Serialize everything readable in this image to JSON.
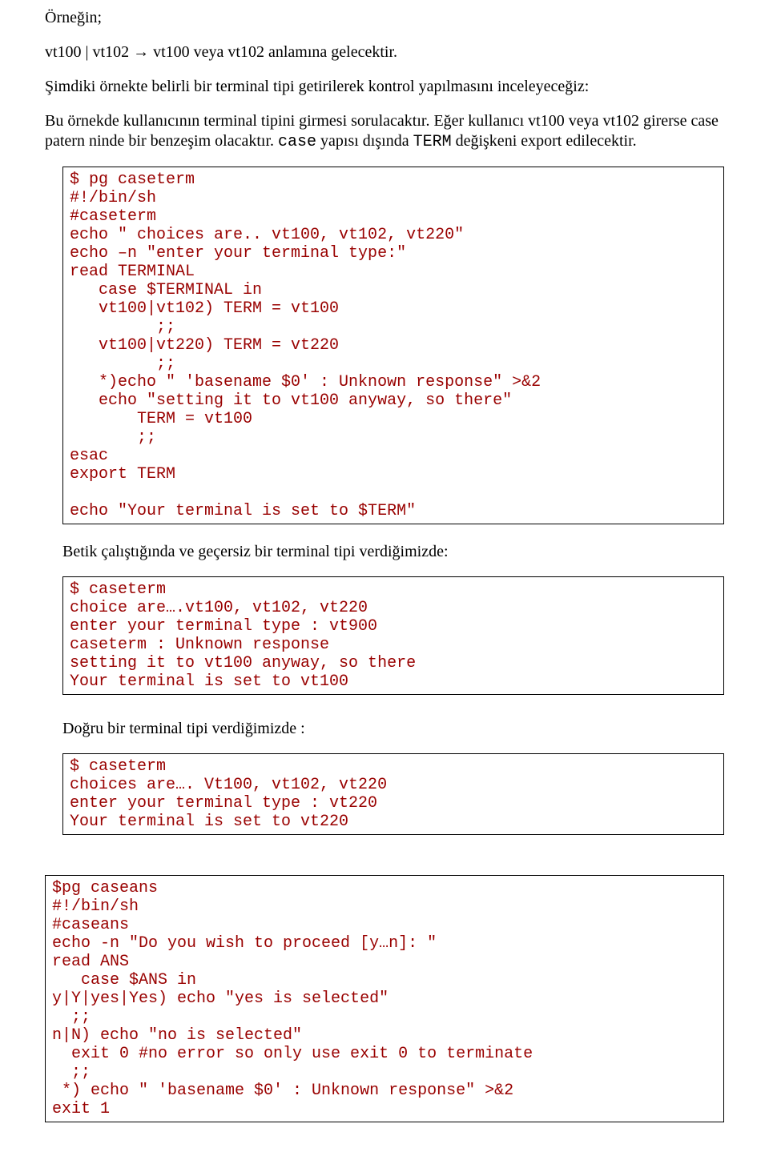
{
  "p1": "Örneğin;",
  "p2_pre": "vt100 | vt102 ",
  "p2_arrow": "→",
  "p2_post": " vt100 veya vt102 anlamına gelecektir.",
  "p3a": "Şimdiki örnekte belirli bir terminal tipi getirilerek kontrol yapılmasını inceleyeceğiz:",
  "p3b_1": "Bu örnekde kullanıcının terminal tipini girmesi sorulacaktır. Eğer kullanıcı vt100 veya vt102 girerse case patern ninde bir benzeşim olacaktır. ",
  "p3b_mono1": "case",
  "p3b_2": " yapısı dışında ",
  "p3b_mono2": "TERM",
  "p3b_3": " değişkeni export edilecektir.",
  "code1": "$ pg caseterm\n#!/bin/sh\n#caseterm\necho \" choices are.. vt100, vt102, vt220\"\necho –n \"enter your terminal type:\"\nread TERMINAL\n   case $TERMINAL in\n   vt100|vt102) TERM = vt100\n         ;;\n   vt100|vt220) TERM = vt220\n         ;;\n   *)echo \" 'basename $0' : Unknown response\" >&2\n   echo \"setting it to vt100 anyway, so there\"\n       TERM = vt100\n       ;;\nesac\nexport TERM\n\necho \"Your terminal is set to $TERM\"",
  "p4": "Betik çalıştığında ve geçersiz bir terminal tipi verdiğimizde:",
  "code2": "$ caseterm\nchoice are….vt100, vt102, vt220\nenter your terminal type : vt900\ncaseterm : Unknown response\nsetting it to vt100 anyway, so there\nYour terminal is set to vt100",
  "p5": "Doğru bir terminal tipi verdiğimizde :",
  "code3": "$ caseterm\nchoices are…. Vt100, vt102, vt220\nenter your terminal type : vt220\nYour terminal is set to vt220",
  "code4": "$pg caseans\n#!/bin/sh\n#caseans\necho -n \"Do you wish to proceed [y…n]: \"\nread ANS\n   case $ANS in\ny|Y|yes|Yes) echo \"yes is selected\"\n  ;;\nn|N) echo \"no is selected\"\n  exit 0 #no error so only use exit 0 to terminate\n  ;;\n *) echo \" 'basename $0' : Unknown response\" >&2\nexit 1"
}
